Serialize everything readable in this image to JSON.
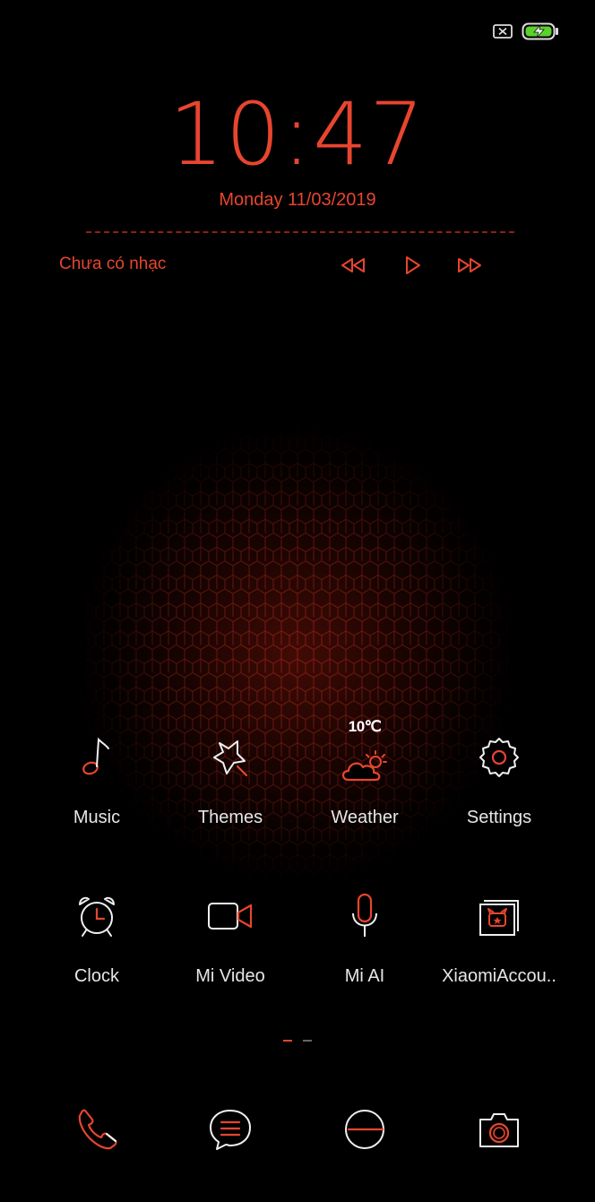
{
  "status": {
    "sim_icon": "no-sim-icon",
    "battery_icon": "battery-charging-icon",
    "battery_color": "#5bd12c"
  },
  "lockclock": {
    "time_hours": "10",
    "time_sep": ":",
    "time_minutes": "47",
    "date": "Monday 11/03/2019",
    "accent_color": "#e8452f"
  },
  "music": {
    "label": "Chưa có nhạc",
    "prev_icon": "rewind-icon",
    "play_icon": "play-icon",
    "next_icon": "fast-forward-icon"
  },
  "apps_row1": [
    {
      "label": "Music",
      "icon": "music-note-icon"
    },
    {
      "label": "Themes",
      "icon": "themes-star-icon"
    },
    {
      "label": "Weather",
      "icon": "weather-cloud-sun-icon",
      "temp": "10℃"
    },
    {
      "label": "Settings",
      "icon": "gear-icon"
    }
  ],
  "apps_row2": [
    {
      "label": "Clock",
      "icon": "alarm-clock-icon"
    },
    {
      "label": "Mi Video",
      "icon": "video-camera-icon"
    },
    {
      "label": "Mi AI",
      "icon": "microphone-icon"
    },
    {
      "label": "XiaomiAccou..",
      "icon": "xiaomi-account-icon"
    }
  ],
  "pages": {
    "count": 2,
    "active": 0
  },
  "dock": [
    {
      "icon": "phone-icon"
    },
    {
      "icon": "messages-icon"
    },
    {
      "icon": "browser-icon"
    },
    {
      "icon": "camera-icon"
    }
  ]
}
